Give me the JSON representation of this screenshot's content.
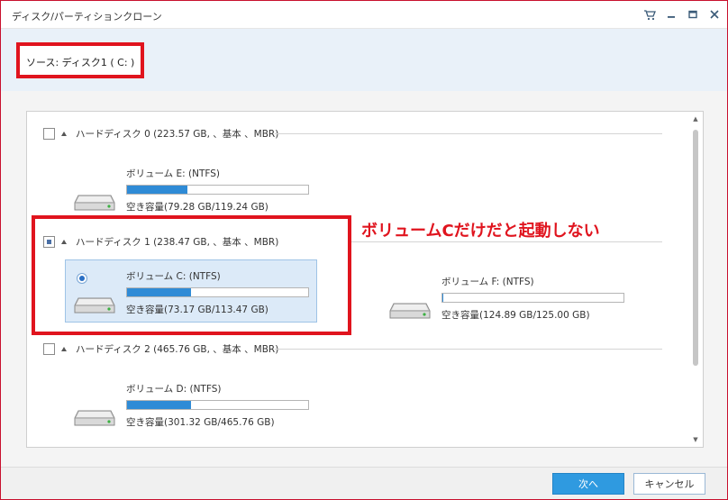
{
  "window": {
    "title": "ディスク/パーティションクローン"
  },
  "source": {
    "text": "ソース:  ディスク1 ( C: )"
  },
  "disks": [
    {
      "label": "ハードディスク 0 (223.57 GB, 、基本 、MBR)",
      "checked": false,
      "volumes": [
        {
          "name": "ボリューム E: (NTFS)",
          "free": "空き容量(79.28 GB/119.24 GB)",
          "used_fraction": 0.335,
          "selected": false
        }
      ]
    },
    {
      "label": "ハードディスク 1 (238.47 GB, 、基本 、MBR)",
      "checked": true,
      "volumes": [
        {
          "name": "ボリューム C: (NTFS)",
          "free": "空き容量(73.17 GB/113.47 GB)",
          "used_fraction": 0.355,
          "selected": true
        },
        {
          "name": "ボリューム F: (NTFS)",
          "free": "空き容量(124.89 GB/125.00 GB)",
          "used_fraction": 0.001,
          "selected": false
        }
      ]
    },
    {
      "label": "ハードディスク 2 (465.76 GB, 、基本 、MBR)",
      "checked": false,
      "volumes": [
        {
          "name": "ボリューム D: (NTFS)",
          "free": "空き容量(301.32 GB/465.76 GB)",
          "used_fraction": 0.353,
          "selected": false
        }
      ]
    }
  ],
  "annotation": {
    "text": "ボリュームCだけだと起動しない",
    "color": "#e0141e"
  },
  "buttons": {
    "next": "次へ",
    "cancel": "キャンセル"
  },
  "colors": {
    "accent": "#2f9ae0",
    "bar_fill": "#2f8bd6",
    "highlight": "#e0141e"
  },
  "icons": [
    "cart-icon",
    "minimize-icon",
    "maximize-icon",
    "close-icon",
    "hard-drive-icon"
  ]
}
